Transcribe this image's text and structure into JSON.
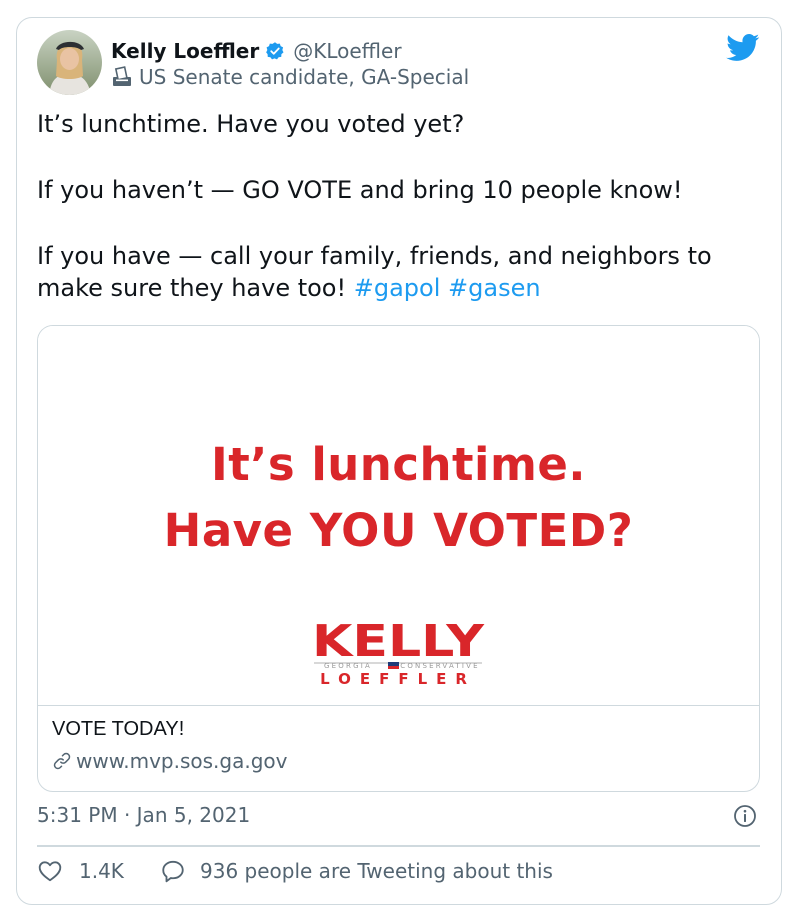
{
  "author": {
    "display_name": "Kelly Loeffler",
    "handle": "@KLoeffler",
    "label": "US Senate candidate, GA-Special"
  },
  "tweet": {
    "line1": "It’s lunchtime. Have you voted yet?",
    "line2": "If you haven’t — GO VOTE and bring 10 people know!",
    "line3": "If you have — call your family, friends, and neighbors to make sure they have too!",
    "hashtags": [
      "#gapol",
      "#gasen"
    ]
  },
  "card": {
    "image_line1": "It’s lunchtime.",
    "image_line2": "Have YOU VOTED?",
    "logo": {
      "name": "KELLY",
      "tagline_left": "GEORGIA",
      "tagline_right": "CONSERVATIVE",
      "surname": "LOEFFLER"
    },
    "title": "VOTE TODAY!",
    "url": "www.mvp.sos.ga.gov"
  },
  "timestamp": "5:31 PM · Jan 5, 2021",
  "actions": {
    "likes": "1.4K",
    "reply_text": "936 people are Tweeting about this"
  },
  "icons": [
    "verified-badge-icon",
    "ballot-box-icon",
    "twitter-bird-icon",
    "link-icon",
    "info-icon",
    "heart-icon",
    "speech-bubble-icon"
  ],
  "colors": {
    "accent": "#1d9bf0",
    "secondary_text": "#536471",
    "promo_red": "#d9262a",
    "border": "#cfd9de"
  }
}
